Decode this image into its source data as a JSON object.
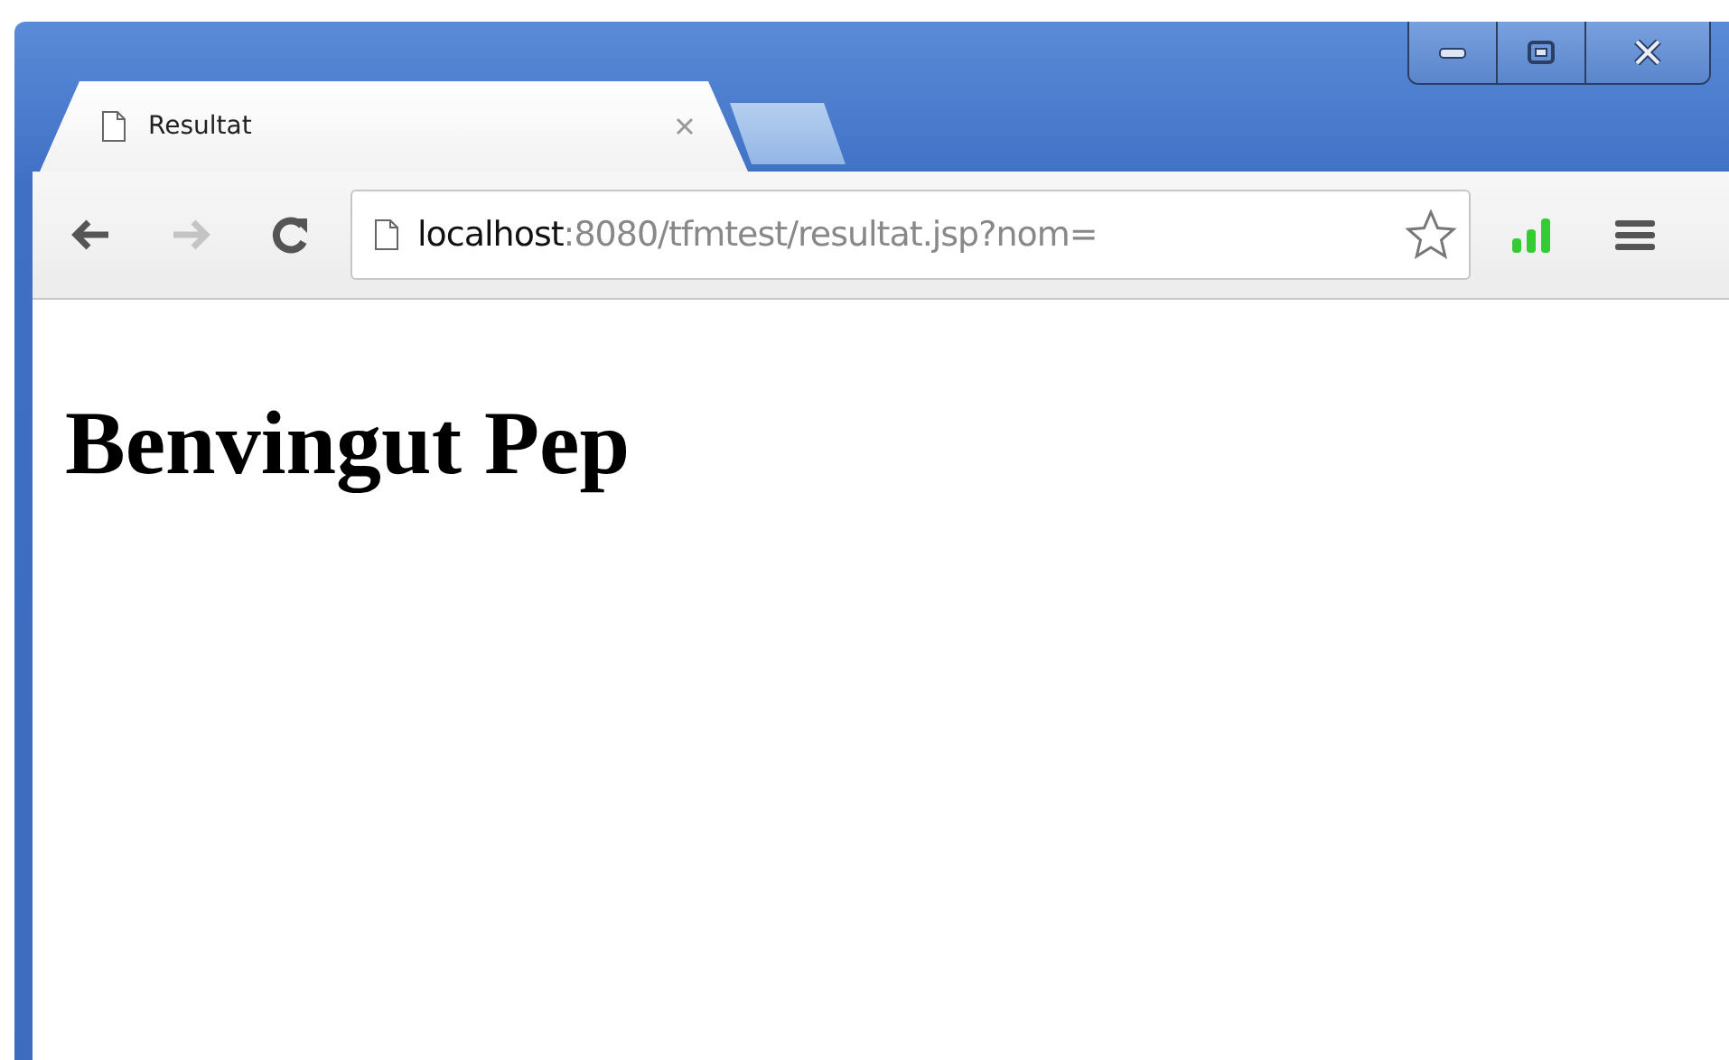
{
  "tabs": [
    {
      "title": "Resultat",
      "selected": true
    }
  ],
  "toolbar": {
    "back": {
      "disabled": false
    },
    "forward": {
      "disabled": true
    }
  },
  "address_bar": {
    "host": "localhost",
    "path": ":8080/tfmtest/resultat.jsp?nom="
  },
  "page": {
    "heading": "Benvingut Pep"
  }
}
